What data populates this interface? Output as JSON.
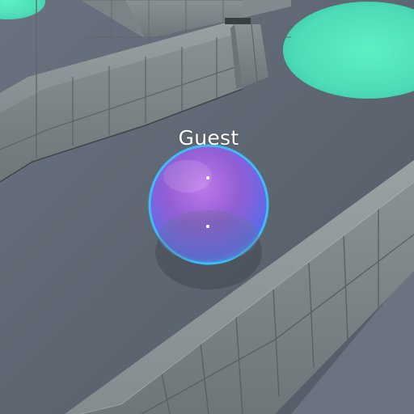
{
  "player": {
    "name": "Guest",
    "label_color": "#ffffff",
    "ball_colors": [
      "#3fb6ff",
      "#7a4bff",
      "#c85cff"
    ]
  },
  "environment": {
    "floor_color": "#5d6571",
    "wall_color": "#8a9296",
    "pad_color": "#4fe3b8"
  }
}
